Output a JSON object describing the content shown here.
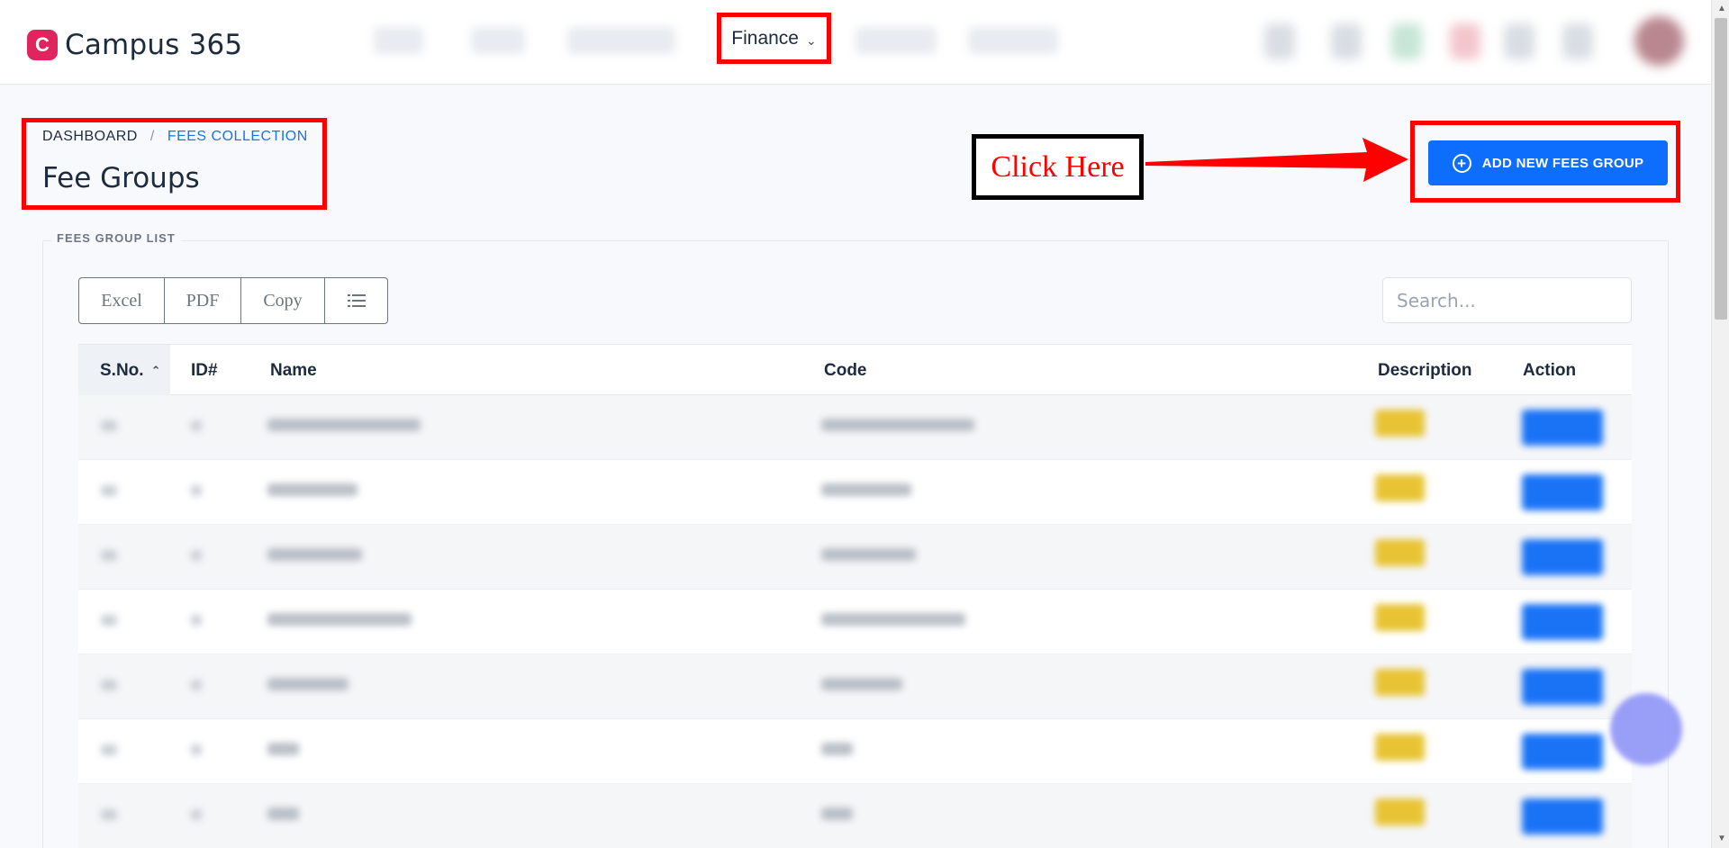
{
  "app": {
    "name": "Campus 365",
    "logo_letter": "C"
  },
  "nav": {
    "finance_label": "Finance",
    "finance_icon": "chevron-down-icon"
  },
  "breadcrumb": {
    "home": "DASHBOARD",
    "separator": "/",
    "current": "FEES COLLECTION"
  },
  "page": {
    "title": "Fee Groups"
  },
  "annotation": {
    "text": "Click Here"
  },
  "actions": {
    "add_label": "ADD NEW FEES GROUP",
    "add_icon": "plus-circle-icon"
  },
  "panel": {
    "legend": "FEES GROUP LIST"
  },
  "toolbar": {
    "buttons": [
      "Excel",
      "PDF",
      "Copy"
    ],
    "column_toggle_icon": "list-icon"
  },
  "search": {
    "placeholder": "Search..."
  },
  "table": {
    "columns": [
      "S.No.",
      "ID#",
      "Name",
      "Code",
      "Description",
      "Action"
    ]
  },
  "colors": {
    "accent": "#0d6efd",
    "highlight": "#ff0000",
    "annotation_text": "#ff0000",
    "brand": "#e0245e"
  }
}
